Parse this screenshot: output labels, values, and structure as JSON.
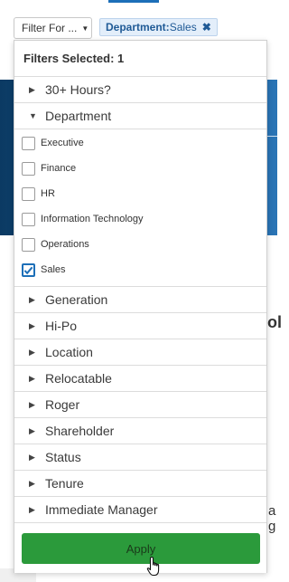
{
  "toolbar": {
    "filter_button_label": "Filter For ...",
    "chip_key": "Department:",
    "chip_value": "Sales"
  },
  "panel": {
    "header": "Filters Selected: 1",
    "sections_top": [
      "30+ Hours?"
    ],
    "expanded_section": "Department",
    "department_options": [
      {
        "label": "Executive",
        "checked": false
      },
      {
        "label": "Finance",
        "checked": false
      },
      {
        "label": "HR",
        "checked": false
      },
      {
        "label": "Information Technology",
        "checked": false
      },
      {
        "label": "Operations",
        "checked": false
      },
      {
        "label": "Sales",
        "checked": true
      }
    ],
    "sections_bottom": [
      "Generation",
      "Hi-Po",
      "Location",
      "Relocatable",
      "Roger",
      "Shareholder",
      "Status",
      "Tenure",
      "Immediate Manager"
    ],
    "apply_label": "Apply"
  },
  "background": {
    "text_ol": "ol",
    "text_ag": "a g"
  },
  "colors": {
    "accent": "#1d6fb8",
    "apply_green": "#2b9a3b",
    "chip_bg": "#e3eefa"
  }
}
